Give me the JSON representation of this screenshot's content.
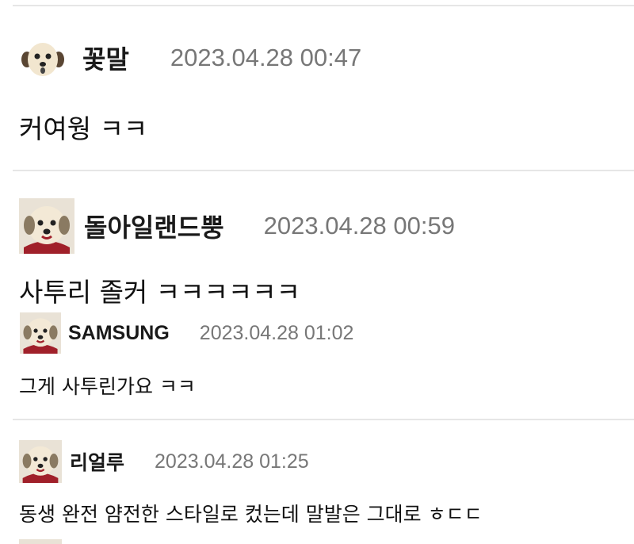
{
  "comments": [
    {
      "author": "꽃말",
      "date": "2023.04.28 00:47",
      "text": "커여웡 ㅋㅋ",
      "avatar_icon": "puppy-face-icon"
    },
    {
      "author": "돌아일랜드뿡",
      "date": "2023.04.28 00:59",
      "text": "사투리 졸커 ㅋㅋㅋㅋㅋㅋ",
      "avatar_icon": "puppy-face-icon"
    },
    {
      "author": "SAMSUNG",
      "date": "2023.04.28 01:02",
      "text": "그게 사투린가요 ㅋㅋ",
      "avatar_icon": "puppy-face-icon",
      "is_reply": true
    },
    {
      "author": "리얼루",
      "date": "2023.04.28 01:25",
      "text": "동생 완전 얌전한 스타일로 컸는데 말발은 그대로 ㅎㄷㄷ",
      "avatar_icon": "puppy-face-icon"
    }
  ],
  "colors": {
    "divider": "#e6e6e6",
    "date_text": "#777777",
    "avatar_red": "#a0202a",
    "avatar_face": "#f1e7d2"
  }
}
